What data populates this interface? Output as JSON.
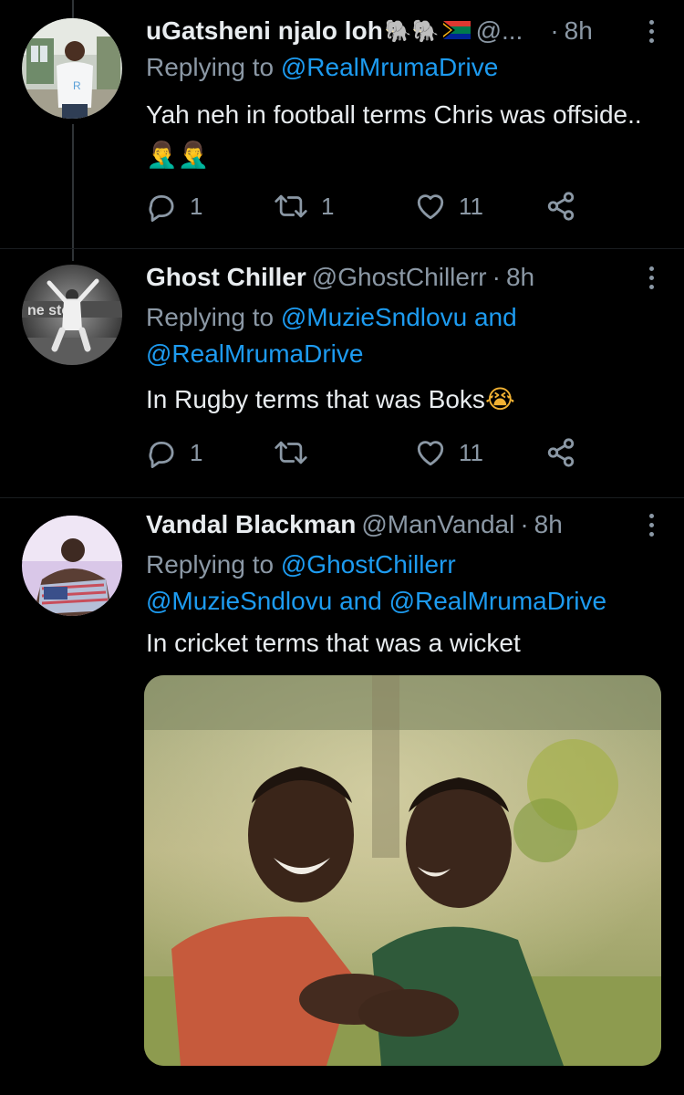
{
  "tweets": [
    {
      "name": "uGatsheni njalo loh",
      "name_emoji": "🐘🐘",
      "handle": "@...",
      "time": "8h",
      "replying_label": "Replying to",
      "mentions": [
        "@RealMrumaDrive"
      ],
      "text": "Yah neh in football terms Chris was offside..",
      "text_emoji": "🤦‍♂️🤦‍♂️",
      "reply_count": "1",
      "retweet_count": "1",
      "like_count": "11"
    },
    {
      "name": "Ghost Chiller",
      "handle": "@GhostChillerr",
      "time": "8h",
      "replying_label": "Replying to",
      "mentions": [
        "@MuzieSndlovu",
        "@RealMrumaDrive"
      ],
      "and_word": "and",
      "text": "In Rugby terms that was Boks",
      "text_emoji": "😭",
      "reply_count": "1",
      "retweet_count": "",
      "like_count": "11"
    },
    {
      "name": "Vandal Blackman",
      "handle": "@ManVandal",
      "time": "8h",
      "replying_label": "Replying to",
      "mentions": [
        "@GhostChillerr",
        "@MuzieSndlovu",
        "@RealMrumaDrive"
      ],
      "and_word": "and",
      "text": "In cricket terms that was a wicket"
    }
  ],
  "separator_dot": "·",
  "icons": {
    "reply": "reply-icon",
    "retweet": "retweet-icon",
    "like": "heart-icon",
    "share": "share-icon",
    "more": "more-vertical-icon"
  },
  "colors": {
    "background": "#000000",
    "text": "#e8ecef",
    "muted": "#8b98a5",
    "link": "#1d9bf0",
    "thread_line": "#2f3336"
  }
}
